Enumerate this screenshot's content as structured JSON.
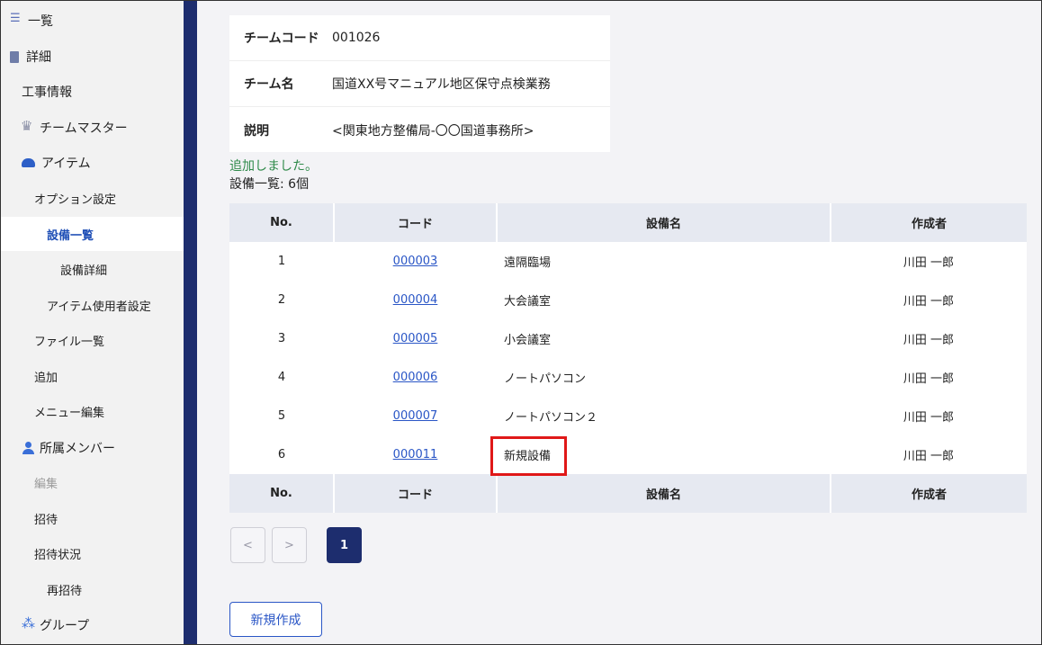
{
  "sidebar": {
    "items": [
      {
        "label": "一覧"
      },
      {
        "label": "詳細"
      },
      {
        "label": "工事情報"
      },
      {
        "label": "チームマスター"
      },
      {
        "label": "アイテム"
      },
      {
        "label": "オプション設定"
      },
      {
        "label": "設備一覧"
      },
      {
        "label": "設備詳細"
      },
      {
        "label": "アイテム使用者設定"
      },
      {
        "label": "ファイル一覧"
      },
      {
        "label": "追加"
      },
      {
        "label": "メニュー編集"
      },
      {
        "label": "所属メンバー"
      },
      {
        "label": "編集"
      },
      {
        "label": "招待"
      },
      {
        "label": "招待状況"
      },
      {
        "label": "再招待"
      },
      {
        "label": "グループ"
      }
    ]
  },
  "team": {
    "code_label": "チームコード",
    "code_value": "001026",
    "name_label": "チーム名",
    "name_value": "国道XX号マニュアル地区保守点検業務",
    "desc_label": "説明",
    "desc_value": "<関東地方整備局-〇〇国道事務所>"
  },
  "messages": {
    "success": "追加しました。",
    "count": "設備一覧: 6個"
  },
  "table": {
    "headers": {
      "no": "No.",
      "code": "コード",
      "name": "設備名",
      "author": "作成者"
    },
    "rows": [
      {
        "no": "1",
        "code": "000003",
        "name": "遠隔臨場",
        "author": "川田 一郎"
      },
      {
        "no": "2",
        "code": "000004",
        "name": "大会議室",
        "author": "川田 一郎"
      },
      {
        "no": "3",
        "code": "000005",
        "name": "小会議室",
        "author": "川田 一郎"
      },
      {
        "no": "4",
        "code": "000006",
        "name": "ノートパソコン",
        "author": "川田 一郎"
      },
      {
        "no": "5",
        "code": "000007",
        "name": "ノートパソコン２",
        "author": "川田 一郎"
      },
      {
        "no": "6",
        "code": "000011",
        "name": "新規設備",
        "author": "川田 一郎"
      }
    ]
  },
  "pager": {
    "prev": "<",
    "next": ">",
    "current": "1"
  },
  "new_button": "新規作成",
  "colors": {
    "accent": "#1d2d6e",
    "link": "#2a56c6",
    "success": "#2f8a4a",
    "highlight": "#e01818"
  }
}
